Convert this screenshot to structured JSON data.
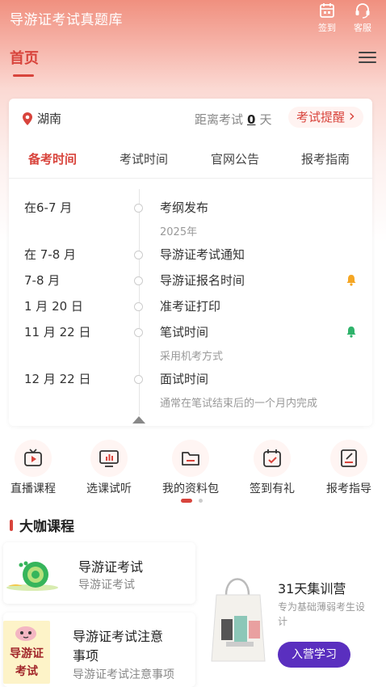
{
  "header": {
    "app_title": "导游证考试真题库",
    "checkin_label": "签到",
    "service_label": "客服",
    "nav_home": "首页"
  },
  "exam_card": {
    "location": "湖南",
    "countdown_prefix": "距离考试",
    "countdown_days": "0",
    "countdown_suffix": "天",
    "remind_label": "考试提醒",
    "remind_chevron": "›",
    "tabs": [
      "备考时间",
      "考试时间",
      "官网公告",
      "报考指南"
    ],
    "active_tab": "备考时间",
    "timeline": [
      {
        "date": "在6-7 月",
        "title": "考纲发布",
        "sub": "2025年"
      },
      {
        "date": "在 7-8 月",
        "title": "导游证考试通知",
        "sub": ""
      },
      {
        "date": "7-8 月",
        "title": "导游证报名时间",
        "sub": "",
        "bell": "orange"
      },
      {
        "date": "1 月 20 日",
        "title": "准考证打印",
        "sub": ""
      },
      {
        "date": "11 月 22 日",
        "title": "笔试时间",
        "sub": "采用机考方式",
        "bell": "green"
      },
      {
        "date": "12 月 22 日",
        "title": "面试时间",
        "sub": "通常在笔试结束后的一个月内完成"
      }
    ]
  },
  "quick_links": [
    {
      "label": "直播课程",
      "icon": "tv-play-icon"
    },
    {
      "label": "选课试听",
      "icon": "monitor-chart-icon"
    },
    {
      "label": "我的资料包",
      "icon": "folder-icon"
    },
    {
      "label": "签到有礼",
      "icon": "calendar-check-icon"
    },
    {
      "label": "报考指导",
      "icon": "document-pen-icon"
    }
  ],
  "section": {
    "title": "大咖课程"
  },
  "courses": [
    {
      "title": "导游证考试",
      "subtitle": "导游证考试"
    },
    {
      "title": "导游证考试注意事项",
      "title_line1": "导游证考试注意",
      "title_line2": "事项",
      "subtitle": "导游证考试注意事项",
      "thumb_text_1": "导游证",
      "thumb_text_2": "考试"
    }
  ],
  "promo": {
    "title": "31天集训营",
    "desc": "专为基础薄弱考生设计",
    "button": "入营学习"
  },
  "colors": {
    "accent": "#d8443c",
    "purple": "#5a2fbf",
    "bell_orange": "#f5a623",
    "bell_green": "#2fb36b"
  }
}
